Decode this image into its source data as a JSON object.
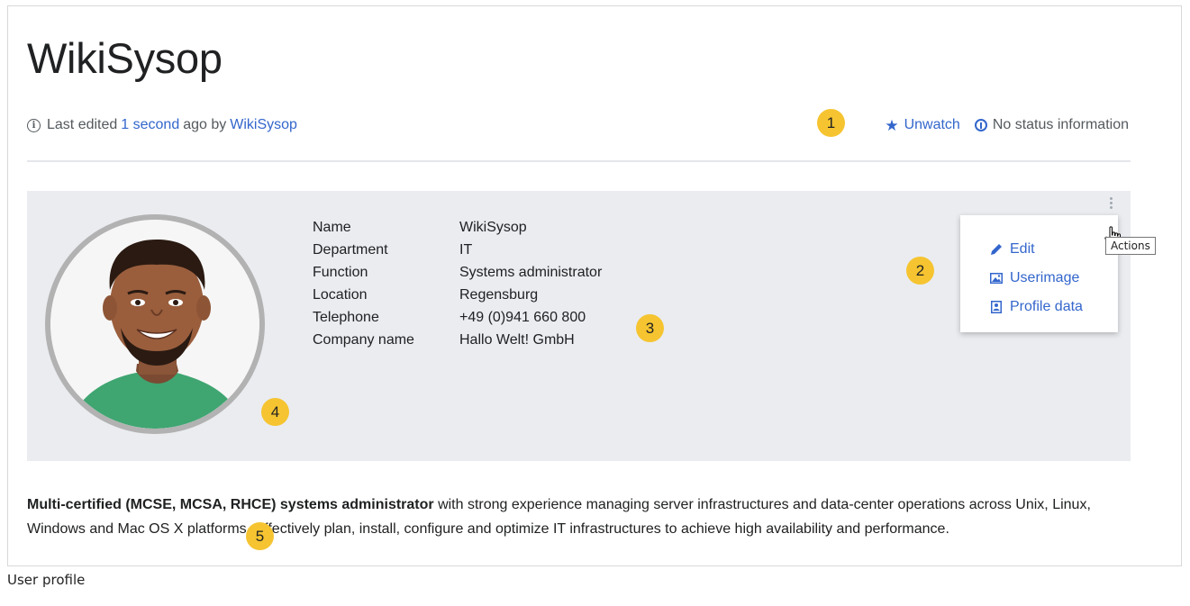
{
  "page": {
    "title": "WikiSysop",
    "caption": "User profile"
  },
  "meta": {
    "prefix": "Last edited",
    "time_link": "1 second",
    "middle": "ago by",
    "author_link": "WikiSysop"
  },
  "tools": {
    "unwatch_label": "Unwatch",
    "status_label": "No status information"
  },
  "profile": {
    "fields": [
      {
        "label": "Name",
        "value": "WikiSysop"
      },
      {
        "label": "Department",
        "value": "IT"
      },
      {
        "label": "Function",
        "value": "Systems administrator"
      },
      {
        "label": "Location",
        "value": "Regensburg"
      },
      {
        "label": "Telephone",
        "value": "+49 (0)941 660 800"
      },
      {
        "label": "Company name",
        "value": "Hallo Welt! GmbH"
      }
    ]
  },
  "actions": {
    "tooltip": "Actions",
    "items": [
      {
        "label": "Edit",
        "icon": "pencil-icon"
      },
      {
        "label": "Userimage",
        "icon": "image-icon"
      },
      {
        "label": "Profile data",
        "icon": "profile-card-icon"
      }
    ]
  },
  "description": {
    "bold": "Multi-certified (MCSE, MCSA, RHCE) systems administrator",
    "rest": " with strong experience managing server infrastructures and data-center operations across Unix, Linux, Windows and Mac OS X platforms. Effectively plan, install, configure and optimize IT infrastructures to achieve high availability and performance."
  },
  "badges": [
    "1",
    "2",
    "3",
    "4",
    "5"
  ],
  "colors": {
    "link": "#3366cc",
    "badge": "#f5c430",
    "panel": "#eaecf0"
  }
}
